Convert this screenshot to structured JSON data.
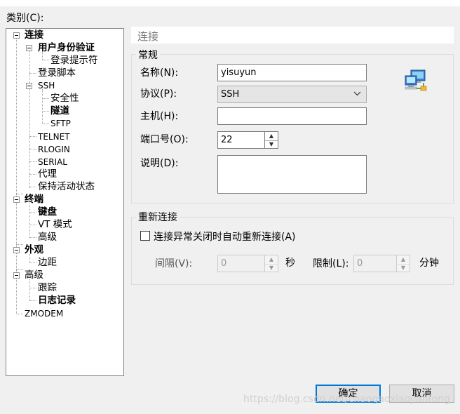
{
  "category_label": "类别(C):",
  "tree": {
    "connection": "连接",
    "auth": "用户身份验证",
    "login_prompts": "登录提示符",
    "login_script": "登录脚本",
    "ssh": "SSH",
    "security": "安全性",
    "tunnel": "隧道",
    "sftp": "SFTP",
    "telnet": "TELNET",
    "rlogin": "RLOGIN",
    "serial": "SERIAL",
    "proxy": "代理",
    "keepalive": "保持活动状态",
    "terminal": "终端",
    "keyboard": "键盘",
    "vt_mode": "VT 模式",
    "term_advanced": "高级",
    "appearance": "外观",
    "margin": "边距",
    "advanced": "高级",
    "trace": "跟踪",
    "logging": "日志记录",
    "zmodem": "ZMODEM"
  },
  "header": {
    "title": "连接"
  },
  "general": {
    "legend": "常规",
    "name_label": "名称(N):",
    "name_value": "yisuyun",
    "protocol_label": "协议(P):",
    "protocol_value": "SSH",
    "host_label": "主机(H):",
    "host_value": "",
    "port_label": "端口号(O):",
    "port_value": "22",
    "desc_label": "说明(D):",
    "desc_value": ""
  },
  "reconnect": {
    "legend": "重新连接",
    "auto_label": "连接异常关闭时自动重新连接(A)",
    "interval_label": "间隔(V):",
    "interval_value": "0",
    "seconds_unit": "秒",
    "limit_label": "限制(L):",
    "limit_value": "0",
    "minutes_unit": "分钟"
  },
  "buttons": {
    "ok": "确定",
    "cancel": "取消"
  },
  "watermark": "https://blog.csdn.net/chaogaoxiaojianfong",
  "icons": {
    "network": "network-computer-icon"
  }
}
